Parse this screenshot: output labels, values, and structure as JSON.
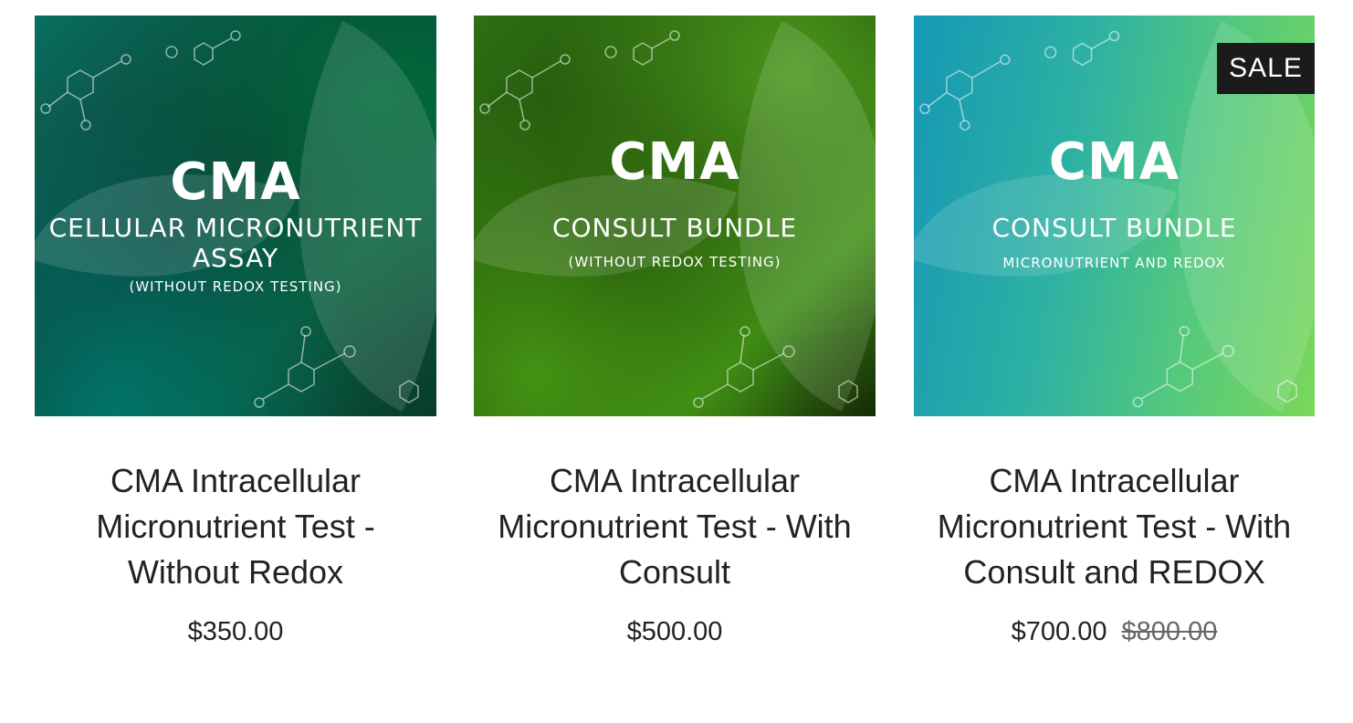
{
  "products": [
    {
      "image": {
        "main": "CMA",
        "line1": "CELLULAR MICRONUTRIENT",
        "line2": "ASSAY",
        "small": "(WITHOUT REDOX TESTING)"
      },
      "title": "CMA Intracellular Micronutrient Test - Without Redox",
      "price": "$350.00"
    },
    {
      "image": {
        "main": "CMA",
        "line1": "CONSULT BUNDLE",
        "small": "(WITHOUT REDOX TESTING)"
      },
      "title": "CMA Intracellular Micronutrient Test - With Consult",
      "price": "$500.00"
    },
    {
      "image": {
        "main": "CMA",
        "line1": "CONSULT BUNDLE",
        "small": "MICRONUTRIENT AND REDOX"
      },
      "badge": "SALE",
      "title": "CMA Intracellular Micronutrient Test - With Consult and REDOX",
      "price": "$700.00",
      "compare_price": "$800.00"
    }
  ],
  "colors": {
    "badge_bg": "#1b1b1b",
    "text": "#222222"
  }
}
